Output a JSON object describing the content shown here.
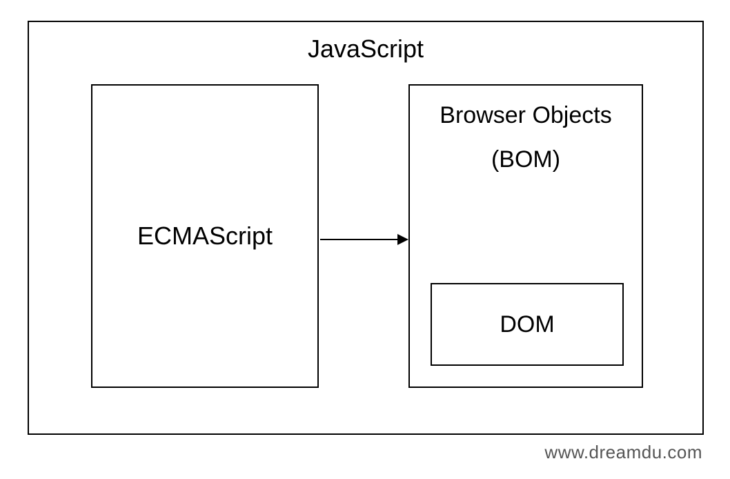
{
  "diagram": {
    "outer_title": "JavaScript",
    "left_box_label": "ECMAScript",
    "right_box_title_line1": "Browser Objects",
    "right_box_title_line2": "(BOM)",
    "dom_label": "DOM"
  },
  "footer": {
    "url": "www.dreamdu.com"
  }
}
